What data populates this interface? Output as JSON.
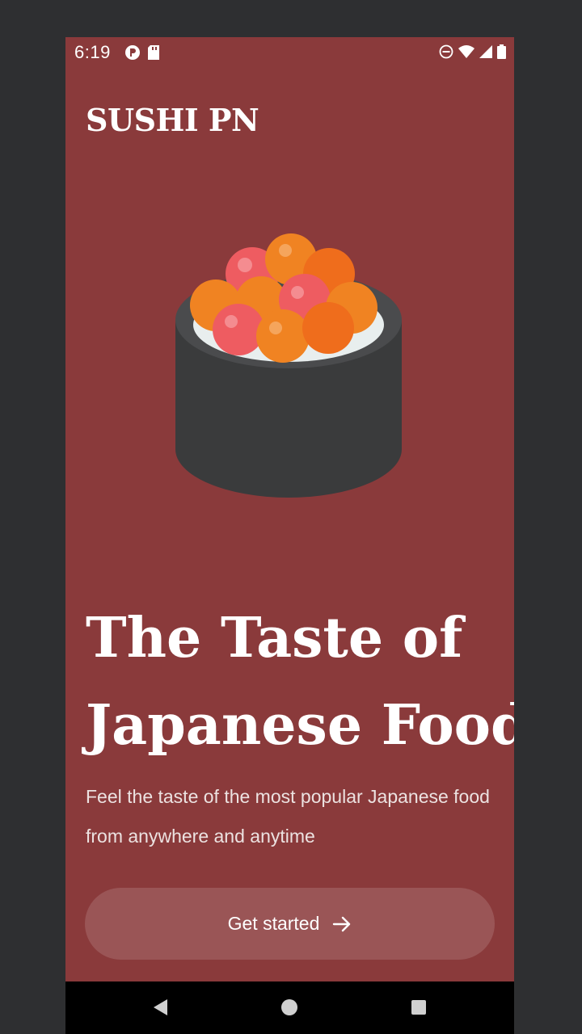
{
  "status_bar": {
    "time": "6:19",
    "left_icons": [
      "media-app-icon",
      "sd-card-icon"
    ],
    "right_icons": [
      "do-not-disturb-icon",
      "wifi-icon",
      "signal-icon",
      "battery-icon"
    ]
  },
  "brand": {
    "name": "SUSHI PN"
  },
  "hero": {
    "image_name": "sushi-roll-illustration",
    "headline_line1": "The Taste of",
    "headline_line2": "Japanese Food",
    "subtitle": "Feel the taste of the most popular Japanese food from anywhere and anytime"
  },
  "cta": {
    "label": "Get started",
    "icon": "arrow-right-icon"
  },
  "nav_bar": {
    "buttons": [
      "back-icon",
      "home-icon",
      "recents-icon"
    ]
  },
  "colors": {
    "background": "#8a3a3b",
    "button_overlay": "rgba(255,255,255,0.14)",
    "text": "#ffffff"
  }
}
